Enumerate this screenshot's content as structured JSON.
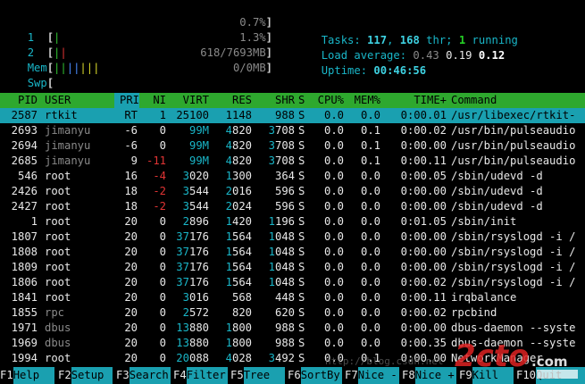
{
  "meters": {
    "cpu1": {
      "label": "1",
      "value": "0.7%",
      "bars": [
        {
          "color": "#30c030",
          "text": "|"
        }
      ]
    },
    "cpu2": {
      "label": "2",
      "value": "1.3%",
      "bars": [
        {
          "color": "#30c030",
          "text": "|"
        },
        {
          "color": "#e03434",
          "text": "|"
        }
      ]
    },
    "mem": {
      "label": "Mem",
      "value": "618/7693MB",
      "bars": [
        {
          "color": "#30c030",
          "text": "|"
        },
        {
          "color": "#30c030",
          "text": "|"
        },
        {
          "color": "#4a8cff",
          "text": "|"
        },
        {
          "color": "#4a8cff",
          "text": "|"
        },
        {
          "color": "#d9d92a",
          "text": "|"
        },
        {
          "color": "#d9d92a",
          "text": "|"
        },
        {
          "color": "#d9d92a",
          "text": "|"
        }
      ]
    },
    "swp": {
      "label": "Swp",
      "value": "0/0MB",
      "bars": []
    }
  },
  "summary": {
    "tasks_label": "Tasks:",
    "tasks": "117",
    "thr": "168",
    "thr_label": "thr;",
    "running": "1",
    "running_label": "running",
    "load_label": "Load average:",
    "load1": "0.43",
    "load5": "0.19",
    "load15": "0.12",
    "uptime_label": "Uptime:",
    "uptime": "00:46:56"
  },
  "columns": [
    "PID",
    "USER",
    "PRI",
    "NI",
    "VIRT",
    "RES",
    "SHR",
    "S",
    "CPU%",
    "MEM%",
    "TIME+",
    "Command"
  ],
  "sort_column": "PRI",
  "processes": [
    {
      "pid": "2587",
      "user": "rtkit",
      "pri": "RT",
      "ni": "1",
      "virt": "25100",
      "res": "1148",
      "shr": "988",
      "s": "S",
      "cpu": "0.0",
      "mem": "0.0",
      "time": "0:00.01",
      "cmd": "/usr/libexec/rtkit-",
      "selected": true
    },
    {
      "pid": "2693",
      "user": "jimanyu",
      "pri": "-6",
      "ni": "0",
      "virt": "99M",
      "res": "4820",
      "shr": "3708",
      "s": "S",
      "cpu": "0.0",
      "mem": "0.1",
      "time": "0:00.02",
      "cmd": "/usr/bin/pulseaudio"
    },
    {
      "pid": "2694",
      "user": "jimanyu",
      "pri": "-6",
      "ni": "0",
      "virt": "99M",
      "res": "4820",
      "shr": "3708",
      "s": "S",
      "cpu": "0.0",
      "mem": "0.1",
      "time": "0:00.00",
      "cmd": "/usr/bin/pulseaudio"
    },
    {
      "pid": "2685",
      "user": "jimanyu",
      "pri": "9",
      "ni": "-11",
      "virt": "99M",
      "res": "4820",
      "shr": "3708",
      "s": "S",
      "cpu": "0.0",
      "mem": "0.1",
      "time": "0:00.11",
      "cmd": "/usr/bin/pulseaudio"
    },
    {
      "pid": "546",
      "user": "root",
      "pri": "16",
      "ni": "-4",
      "virt": "3020",
      "res": "1300",
      "shr": "364",
      "s": "S",
      "cpu": "0.0",
      "mem": "0.0",
      "time": "0:00.05",
      "cmd": "/sbin/udevd -d"
    },
    {
      "pid": "2426",
      "user": "root",
      "pri": "18",
      "ni": "-2",
      "virt": "3544",
      "res": "2016",
      "shr": "596",
      "s": "S",
      "cpu": "0.0",
      "mem": "0.0",
      "time": "0:00.00",
      "cmd": "/sbin/udevd -d"
    },
    {
      "pid": "2427",
      "user": "root",
      "pri": "18",
      "ni": "-2",
      "virt": "3544",
      "res": "2024",
      "shr": "596",
      "s": "S",
      "cpu": "0.0",
      "mem": "0.0",
      "time": "0:00.00",
      "cmd": "/sbin/udevd -d"
    },
    {
      "pid": "1",
      "user": "root",
      "pri": "20",
      "ni": "0",
      "virt": "2896",
      "res": "1420",
      "shr": "1196",
      "s": "S",
      "cpu": "0.0",
      "mem": "0.0",
      "time": "0:01.05",
      "cmd": "/sbin/init"
    },
    {
      "pid": "1807",
      "user": "root",
      "pri": "20",
      "ni": "0",
      "virt": "37176",
      "res": "1564",
      "shr": "1048",
      "s": "S",
      "cpu": "0.0",
      "mem": "0.0",
      "time": "0:00.00",
      "cmd": "/sbin/rsyslogd -i /"
    },
    {
      "pid": "1808",
      "user": "root",
      "pri": "20",
      "ni": "0",
      "virt": "37176",
      "res": "1564",
      "shr": "1048",
      "s": "S",
      "cpu": "0.0",
      "mem": "0.0",
      "time": "0:00.00",
      "cmd": "/sbin/rsyslogd -i /"
    },
    {
      "pid": "1809",
      "user": "root",
      "pri": "20",
      "ni": "0",
      "virt": "37176",
      "res": "1564",
      "shr": "1048",
      "s": "S",
      "cpu": "0.0",
      "mem": "0.0",
      "time": "0:00.00",
      "cmd": "/sbin/rsyslogd -i /"
    },
    {
      "pid": "1806",
      "user": "root",
      "pri": "20",
      "ni": "0",
      "virt": "37176",
      "res": "1564",
      "shr": "1048",
      "s": "S",
      "cpu": "0.0",
      "mem": "0.0",
      "time": "0:00.02",
      "cmd": "/sbin/rsyslogd -i /"
    },
    {
      "pid": "1841",
      "user": "root",
      "pri": "20",
      "ni": "0",
      "virt": "3016",
      "res": "568",
      "shr": "448",
      "s": "S",
      "cpu": "0.0",
      "mem": "0.0",
      "time": "0:00.11",
      "cmd": "irqbalance"
    },
    {
      "pid": "1855",
      "user": "rpc",
      "pri": "20",
      "ni": "0",
      "virt": "2572",
      "res": "820",
      "shr": "620",
      "s": "S",
      "cpu": "0.0",
      "mem": "0.0",
      "time": "0:00.02",
      "cmd": "rpcbind"
    },
    {
      "pid": "1971",
      "user": "dbus",
      "pri": "20",
      "ni": "0",
      "virt": "13880",
      "res": "1800",
      "shr": "988",
      "s": "S",
      "cpu": "0.0",
      "mem": "0.0",
      "time": "0:00.00",
      "cmd": "dbus-daemon --syste"
    },
    {
      "pid": "1969",
      "user": "dbus",
      "pri": "20",
      "ni": "0",
      "virt": "13880",
      "res": "1800",
      "shr": "988",
      "s": "S",
      "cpu": "0.0",
      "mem": "0.0",
      "time": "0:00.35",
      "cmd": "dbus-daemon --syste"
    },
    {
      "pid": "1994",
      "user": "root",
      "pri": "20",
      "ni": "0",
      "virt": "20088",
      "res": "4028",
      "shr": "3492",
      "s": "S",
      "cpu": "0.0",
      "mem": "0.1",
      "time": "0:00.00",
      "cmd": "NetworkManager"
    }
  ],
  "function_keys": [
    {
      "key": "F1",
      "label": "Help"
    },
    {
      "key": "F2",
      "label": "Setup"
    },
    {
      "key": "F3",
      "label": "Search"
    },
    {
      "key": "F4",
      "label": "Filter"
    },
    {
      "key": "F5",
      "label": "Tree"
    },
    {
      "key": "F6",
      "label": "SortBy"
    },
    {
      "key": "F7",
      "label": "Nice -"
    },
    {
      "key": "F8",
      "label": "Nice +"
    },
    {
      "key": "F9",
      "label": "Kill"
    },
    {
      "key": "F10",
      "label": "Quit"
    }
  ],
  "watermark": {
    "text": "2cto.com",
    "caption": "http://blog.csdn.net"
  },
  "colors": {
    "header_bg": "#2ea82e",
    "selected_bg": "#1aa0b0",
    "accent_cyan": "#19b6c8"
  }
}
